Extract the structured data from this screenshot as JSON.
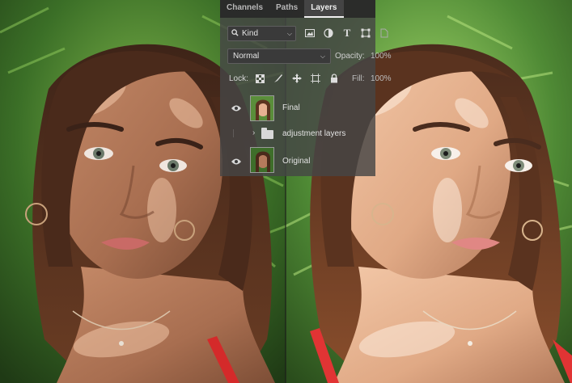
{
  "panel": {
    "tabs": [
      {
        "label": "Channels"
      },
      {
        "label": "Paths"
      },
      {
        "label": "Layers"
      }
    ],
    "kind_filter": {
      "label": "Kind"
    },
    "filter_icons": [
      "image-filter-icon",
      "adjustment-filter-icon",
      "type-filter-icon",
      "shape-filter-icon",
      "smart-object-filter-icon"
    ],
    "blend_mode": "Normal",
    "opacity_label": "Opacity:",
    "opacity_value": "100%",
    "lock_label": "Lock:",
    "lock_icons": [
      "lock-transparent-icon",
      "lock-image-icon",
      "lock-position-icon",
      "lock-artboard-icon",
      "lock-all-icon"
    ],
    "fill_label": "Fill:",
    "fill_value": "100%",
    "layers": [
      {
        "name": "Final",
        "visible": true,
        "type": "image"
      },
      {
        "name": "adjustment layers",
        "visible": false,
        "type": "group"
      },
      {
        "name": "Original",
        "visible": true,
        "type": "image"
      }
    ]
  },
  "colors": {
    "panel_bg": "#464646",
    "foliage": "#3f7a2c",
    "skin_before": "#b57a5c",
    "skin_after": "#e7b493",
    "hair": "#5b3320",
    "strap": "#d42a2a"
  }
}
